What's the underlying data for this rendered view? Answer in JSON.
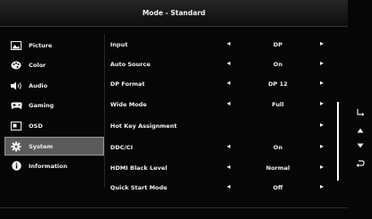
{
  "title": "Mode - Standard",
  "sidebar": {
    "items": [
      {
        "label": "Picture",
        "icon": "picture-icon"
      },
      {
        "label": "Color",
        "icon": "palette-icon"
      },
      {
        "label": "Audio",
        "icon": "speaker-icon"
      },
      {
        "label": "Gaming",
        "icon": "gamepad-icon"
      },
      {
        "label": "OSD",
        "icon": "osd-window-icon"
      },
      {
        "label": "System",
        "icon": "gear-icon",
        "selected": true
      },
      {
        "label": "Information",
        "icon": "info-icon"
      }
    ]
  },
  "settings": {
    "rows": [
      {
        "label": "Input",
        "value": "DP",
        "left_arrow": true,
        "right_arrow": true
      },
      {
        "label": "Auto Source",
        "value": "On",
        "left_arrow": true,
        "right_arrow": true
      },
      {
        "label": "DP Format",
        "value": "DP 12",
        "left_arrow": true,
        "right_arrow": true
      },
      {
        "label": "Wide Mode",
        "value": "Full",
        "left_arrow": true,
        "right_arrow": true
      },
      {
        "label": "Hot Key Assignment",
        "value": "",
        "left_arrow": false,
        "right_arrow": true
      },
      {
        "label": "DDC/CI",
        "value": "On",
        "left_arrow": true,
        "right_arrow": true
      },
      {
        "label": "HDMI Black Level",
        "value": "Normal",
        "left_arrow": true,
        "right_arrow": true
      },
      {
        "label": "Quick Start Mode",
        "value": "Off",
        "left_arrow": true,
        "right_arrow": true
      }
    ]
  },
  "nav_keys": [
    {
      "icon": "enter-arrow-icon"
    },
    {
      "icon": "up-triangle-icon"
    },
    {
      "icon": "down-triangle-icon"
    },
    {
      "icon": "back-return-icon"
    }
  ],
  "colors": {
    "background": "#060606",
    "selected": "#5b5b5b",
    "text": "#f0f0f0"
  }
}
